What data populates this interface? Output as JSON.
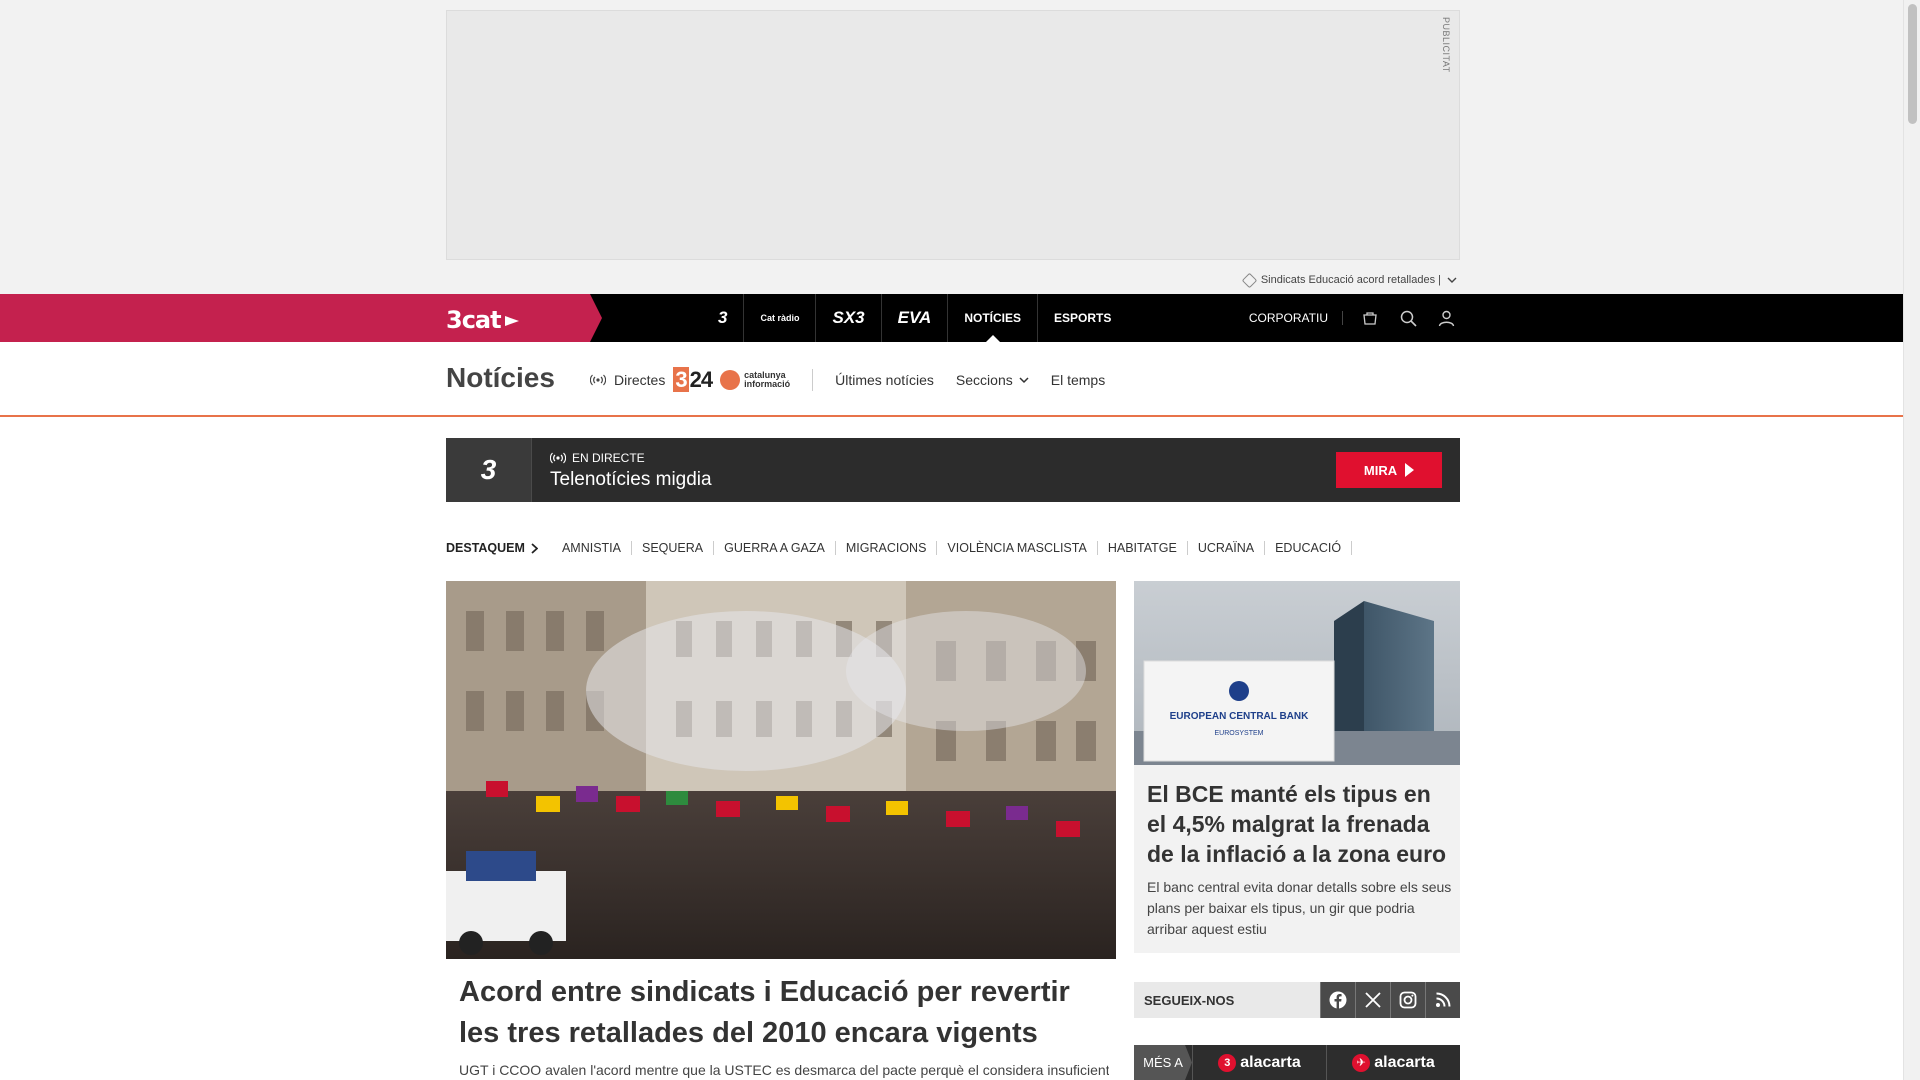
{
  "ad": {
    "label": "PUBLICITAT",
    "tags": "Sindicats Educació acord retallades |"
  },
  "topnav": {
    "brand": "3cat",
    "channels": [
      {
        "label": "3",
        "style": "logo"
      },
      {
        "label": "Cat ràdio",
        "style": "logo"
      },
      {
        "label": "SX3",
        "style": "logo"
      },
      {
        "label": "EVA",
        "style": "logo"
      },
      {
        "label": "NOTÍCIES",
        "style": "text",
        "active": true
      },
      {
        "label": "ESPORTS",
        "style": "text"
      }
    ],
    "corporate": "CORPORATIU",
    "icons": [
      "shop-icon",
      "search-icon",
      "user-icon"
    ]
  },
  "section": {
    "title": "Notícies",
    "directes": "Directes",
    "logo_324_badge": "3",
    "logo_324_text": "24",
    "logo_ci_line1": "catalunya",
    "logo_ci_line2": "informació",
    "links": {
      "ultimes": "Últimes notícies",
      "seccions": "Seccions",
      "temps": "El temps"
    }
  },
  "live": {
    "channel_logo": "3",
    "label": "EN DIRECTE",
    "title": "Telenotícies migdia",
    "button": "MIRA"
  },
  "destaquem": {
    "label": "DESTAQUEM",
    "items": [
      "AMNISTIA",
      "SEQUERA",
      "GUERRA A GAZA",
      "MIGRACIONS",
      "VIOLÈNCIA MASCLISTA",
      "HABITATGE",
      "UCRAÏNA",
      "EDUCACIÓ"
    ]
  },
  "main_story": {
    "title": "Acord entre sindicats i Educació per revertir les tres retallades del 2010 encara vigents",
    "subtitle": "UGT i CCOO avalen l'acord mentre que la USTEC es desmarca del pacte perquè el considera insuficient i"
  },
  "side_story": {
    "image_sign_line1": "EUROPEAN CENTRAL BANK",
    "image_sign_line2": "EUROSYSTEM",
    "title": "El BCE manté els tipus en el 4,5% malgrat la frenada de la inflació a la zona euro",
    "subtitle": "El banc central evita donar detalls sobre els seus plans per baixar els tipus, un gir que podria arribar aquest estiu"
  },
  "follow": {
    "label": "SEGUEIX-NOS",
    "networks": [
      "facebook-icon",
      "x-icon",
      "instagram-icon",
      "rss-icon"
    ]
  },
  "mesa": {
    "label": "MÉS A",
    "items": [
      {
        "badge": "3",
        "text": "alacarta"
      },
      {
        "badge": "✈",
        "text": "alacarta"
      }
    ]
  }
}
